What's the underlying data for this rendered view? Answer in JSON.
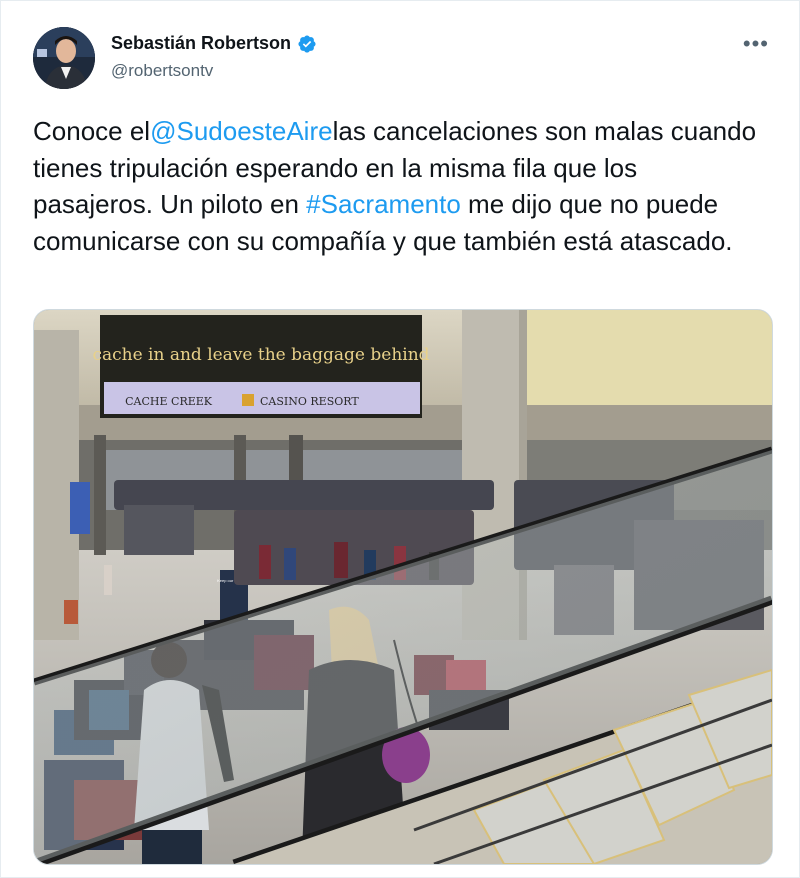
{
  "author": {
    "name": "Sebastián Robertson",
    "handle": "@robertsontv",
    "verified": true
  },
  "menu": {
    "more_label": "•••"
  },
  "tweet": {
    "segments": [
      {
        "type": "text",
        "text": "Conoce el"
      },
      {
        "type": "mention",
        "text": "@SudoesteAire"
      },
      {
        "type": "text",
        "text": "las cancelaciones son malas cuando tienes tripulación esperando en la misma fila que los pasajeros. Un piloto en "
      },
      {
        "type": "hashtag",
        "text": "#Sacramento"
      },
      {
        "type": "text",
        "text": " me dijo que no puede comunicarse con su compañía y que también está atascado."
      }
    ]
  },
  "media": {
    "sign_headline": "cache in and leave the baggage behind",
    "sign_brand_left": "CACHE CREEK",
    "sign_brand_right": "CASINO RESORT",
    "small_sign": "Keep our floor safe"
  },
  "colors": {
    "link": "#1d9bf0",
    "verified": "#1d9bf0",
    "text": "#0f1419",
    "secondary": "#536471"
  }
}
